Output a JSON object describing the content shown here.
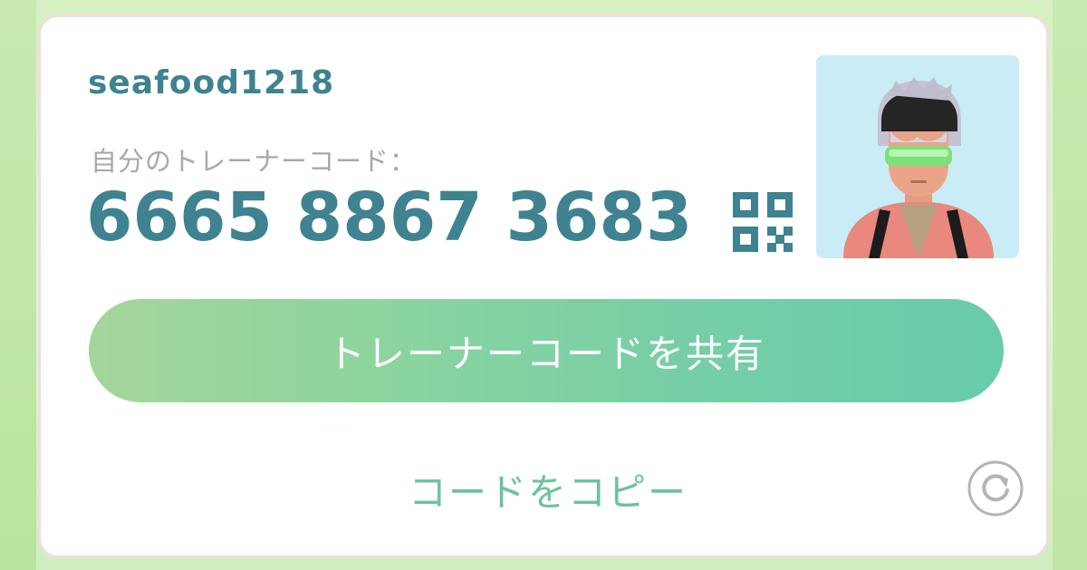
{
  "profile": {
    "username": "seafood1218",
    "code_label": "自分のトレーナーコード：",
    "code_value": "6665 8867 3683"
  },
  "actions": {
    "share_label": "トレーナーコードを共有",
    "copy_label": "コードをコピー"
  },
  "icons": {
    "qr": "qr-code-icon",
    "refresh": "refresh-icon",
    "avatar": "trainer-avatar"
  },
  "colors": {
    "accent_text": "#3f8290",
    "label_gray": "#a8a8a8",
    "copy_green": "#6cc39c",
    "share_gradient_start": "#a5d59a",
    "share_gradient_end": "#68ccab",
    "card_border": "#f3dcdc"
  }
}
